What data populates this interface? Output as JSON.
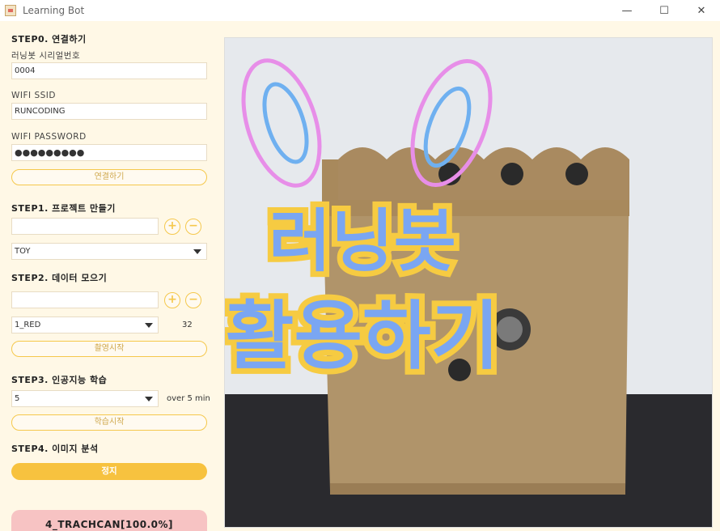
{
  "window": {
    "title": "Learning Bot",
    "minimize": "—",
    "maximize": "☐",
    "close": "✕"
  },
  "step0": {
    "title": "STEP0. 연결하기",
    "serial_label": "러닝봇 시리얼번호",
    "serial_value": "0004",
    "ssid_label": "WIFI SSID",
    "ssid_value": "RUNCODING",
    "password_label": "WIFI PASSWORD",
    "password_value": "●●●●●●●●●",
    "connect_button": "연결하기"
  },
  "step1": {
    "title": "STEP1. 프로젝트 만들기",
    "project_input": "",
    "add": "+",
    "remove": "−",
    "project_select": "TOY"
  },
  "step2": {
    "title": "STEP2. 데이터 모으기",
    "class_input": "",
    "add": "+",
    "remove": "−",
    "class_select": "1_RED",
    "count": "32",
    "capture_button": "촬영시작"
  },
  "step3": {
    "title": "STEP3. 인공지능 학습",
    "epochs_select": "5",
    "time_note": "over 5 min",
    "train_button": "학습시작"
  },
  "step4": {
    "title": "STEP4. 이미지 분석",
    "stop_button": "정지",
    "result": "4_TRACHCAN[100.0%]"
  },
  "camera": {
    "overlay_line1": "러닝봇",
    "overlay_line2": "활용하기"
  }
}
